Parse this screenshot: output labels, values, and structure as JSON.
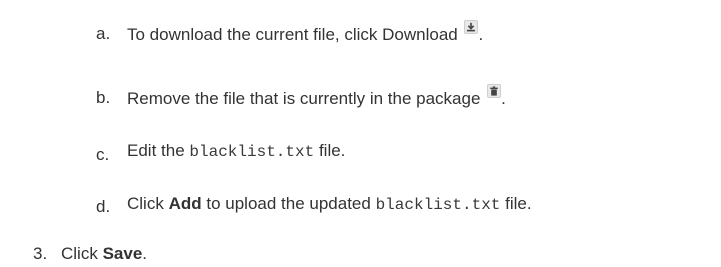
{
  "steps": [
    {
      "marker": "a.",
      "text_before": "To download the current file, click Download",
      "icon": "download-icon",
      "text_after": "."
    },
    {
      "marker": "b.",
      "text_before": "Remove the file that is currently in the package",
      "icon": "trash-icon",
      "text_after": "."
    },
    {
      "marker": "c.",
      "text_before": "Edit the",
      "code": "blacklist.txt",
      "text_after": "file."
    },
    {
      "marker": "d.",
      "text_before": "Click",
      "bold": "Add",
      "text_middle": "to upload the updated",
      "code": "blacklist.txt",
      "text_after": "file."
    }
  ],
  "main_step": {
    "marker": "3.",
    "text_before": "Click",
    "bold": "Save",
    "text_after": "."
  }
}
